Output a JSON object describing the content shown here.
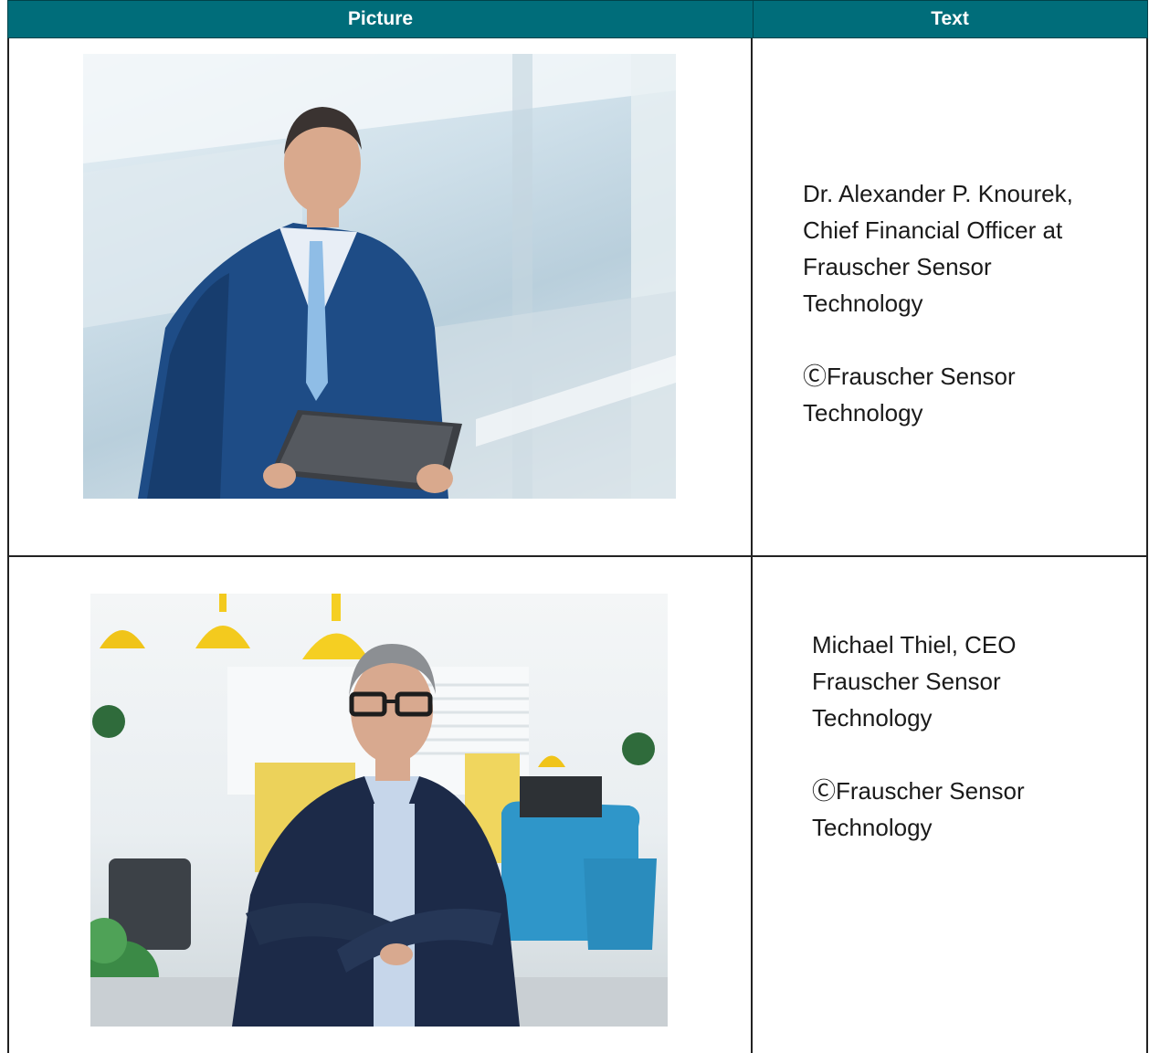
{
  "table": {
    "headers": {
      "picture": "Picture",
      "text": "Text"
    },
    "rows": [
      {
        "caption_lines": [
          "Dr. Alexander P. Knourek,",
          "Chief Financial Officer at",
          "Frauscher Sensor",
          "Technology"
        ],
        "credit_lines": [
          "ⒸFrauscher Sensor",
          "Technology"
        ],
        "photo_subject": "man in blue suit holding tablet"
      },
      {
        "caption_lines": [
          "Michael Thiel, CEO",
          "Frauscher Sensor",
          "Technology"
        ],
        "credit_lines": [
          "ⒸFrauscher Sensor",
          "Technology"
        ],
        "photo_subject": "man in glasses with arms crossed in office"
      }
    ]
  },
  "colors": {
    "header_bg": "#006d7a",
    "header_text": "#ffffff",
    "border": "#222222"
  }
}
